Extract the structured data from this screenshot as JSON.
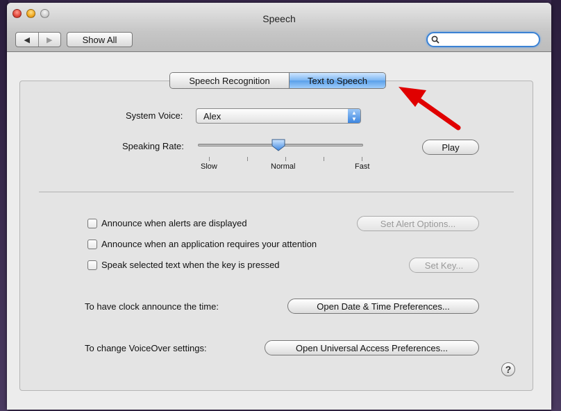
{
  "window": {
    "title": "Speech"
  },
  "toolbar": {
    "back_glyph": "◀",
    "forward_glyph": "▶",
    "show_all_label": "Show All",
    "search_placeholder": "",
    "search_glyph": "🔍"
  },
  "tabs": [
    {
      "label": "Speech Recognition",
      "selected": false
    },
    {
      "label": "Text to Speech",
      "selected": true
    }
  ],
  "voice": {
    "label": "System Voice:",
    "value": "Alex"
  },
  "rate": {
    "label": "Speaking Rate:",
    "slow": "Slow",
    "normal": "Normal",
    "fast": "Fast",
    "play_label": "Play",
    "level": 0.5
  },
  "options": [
    {
      "label": "Announce when alerts are displayed",
      "checked": false,
      "button": "Set Alert Options...",
      "button_enabled": false
    },
    {
      "label": "Announce when an application requires your attention",
      "checked": false
    },
    {
      "label": "Speak selected text when the key is pressed",
      "checked": false,
      "button": "Set Key...",
      "button_enabled": false
    }
  ],
  "clock": {
    "label": "To have clock announce the time:",
    "button": "Open Date & Time Preferences..."
  },
  "voiceover": {
    "label": "To change VoiceOver settings:",
    "button": "Open Universal Access Preferences..."
  },
  "help": {
    "glyph": "?"
  },
  "colors": {
    "selected_tab": "#5aa0ea",
    "annotation_arrow": "#e00000",
    "focus_ring": "#3b82d4"
  }
}
